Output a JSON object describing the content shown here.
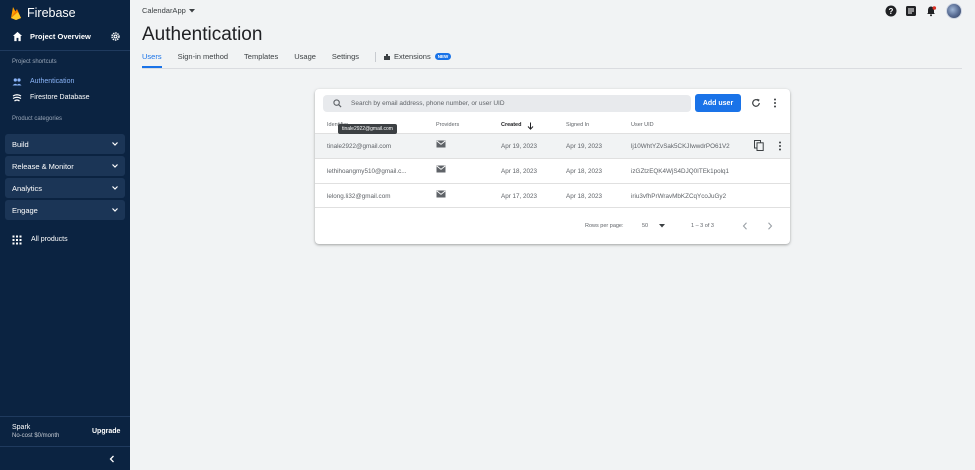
{
  "colors": {
    "sidebar_bg": "#0b2341",
    "accent": "#1a73e8",
    "page_bg": "#f1f3f4"
  },
  "sidebar": {
    "brand": "Firebase",
    "project_overview": "Project Overview",
    "shortcuts_label": "Project shortcuts",
    "shortcuts": [
      {
        "label": "Authentication",
        "icon": "people-icon",
        "active": true
      },
      {
        "label": "Firestore Database",
        "icon": "firestore-icon",
        "active": false
      }
    ],
    "categories_label": "Product categories",
    "categories": [
      {
        "label": "Build"
      },
      {
        "label": "Release & Monitor"
      },
      {
        "label": "Analytics"
      },
      {
        "label": "Engage"
      }
    ],
    "all_products": "All products",
    "plan_name": "Spark",
    "plan_cost": "No-cost $0/month",
    "upgrade": "Upgrade"
  },
  "header": {
    "project": "CalendarApp",
    "title": "Authentication",
    "tabs": [
      {
        "label": "Users",
        "active": true
      },
      {
        "label": "Sign-in method",
        "active": false
      },
      {
        "label": "Templates",
        "active": false
      },
      {
        "label": "Usage",
        "active": false
      },
      {
        "label": "Settings",
        "active": false
      }
    ],
    "extensions": "Extensions",
    "extensions_badge": "NEW"
  },
  "users": {
    "search_placeholder": "Search by email address, phone number, or user UID",
    "add_user": "Add user",
    "columns": [
      "Identifier",
      "Providers",
      "Created",
      "Signed In",
      "User UID"
    ],
    "sorted_column": "Created",
    "tooltip": "tinale2922@gmail.com",
    "rows": [
      {
        "identifier": "tinale2922@gmail.com",
        "provider": "mail-icon",
        "created": "Apr 19, 2023",
        "signed_in": "Apr 19, 2023",
        "uid": "lj10WhtYZvSak5CKJIwwdrPO61V2"
      },
      {
        "identifier": "lethihoangmy510@gmail.c...",
        "provider": "mail-icon",
        "created": "Apr 18, 2023",
        "signed_in": "Apr 18, 2023",
        "uid": "izGZtzEQK4WjS4DJQ0ITEk1polq1"
      },
      {
        "identifier": "lelong.li32@gmail.com",
        "provider": "mail-icon",
        "created": "Apr 17, 2023",
        "signed_in": "Apr 18, 2023",
        "uid": "iriu3vfhPrWravMbKZCqYcoJuGy2"
      }
    ],
    "rows_per_page_label": "Rows per page:",
    "rows_per_page": "50",
    "range": "1 – 3 of 3"
  }
}
